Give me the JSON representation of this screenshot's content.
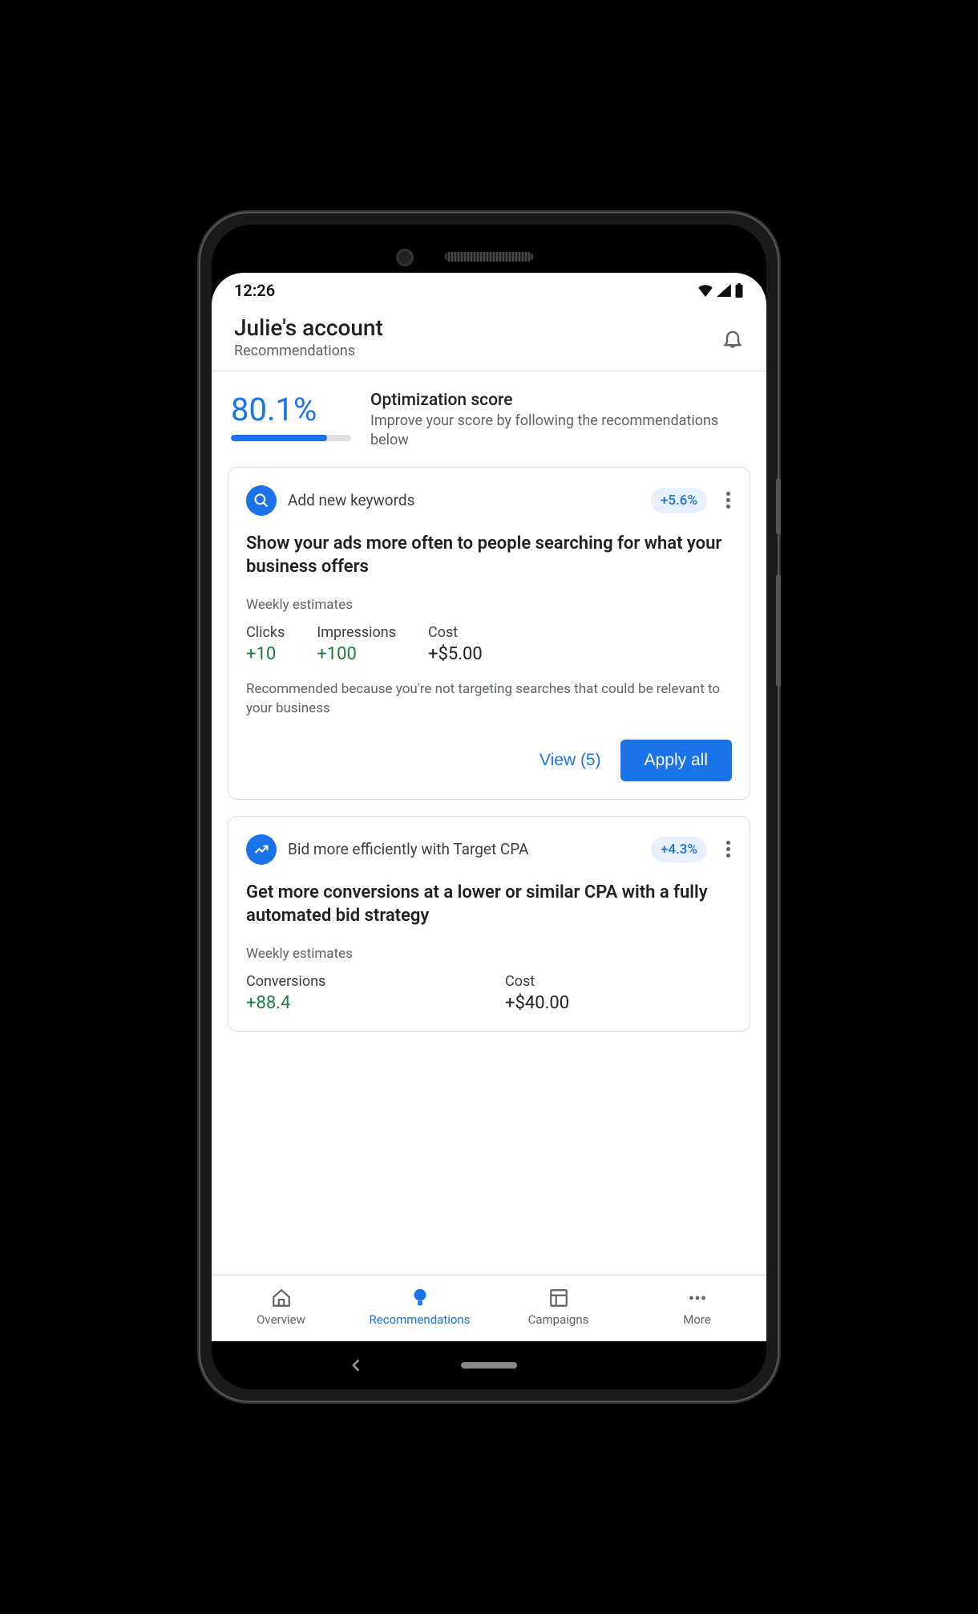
{
  "statusbar": {
    "time": "12:26"
  },
  "header": {
    "title": "Julie's account",
    "subtitle": "Recommendations"
  },
  "score": {
    "value": "80.1%",
    "fill_percent": 80.1,
    "title": "Optimization score",
    "desc": "Improve your score by following the recommendations below"
  },
  "cards": [
    {
      "icon": "search",
      "title": "Add new keywords",
      "badge": "+5.6%",
      "heading": "Show your ads more often to people searching for what your business offers",
      "weekly_label": "Weekly estimates",
      "metrics": [
        {
          "label": "Clicks",
          "value": "+10",
          "color": "green"
        },
        {
          "label": "Impressions",
          "value": "+100",
          "color": "green"
        },
        {
          "label": "Cost",
          "value": "+$5.00",
          "color": "black"
        }
      ],
      "footer_text": "Recommended because you're not targeting searches that could be relevant to your business",
      "view_label": "View (5)",
      "apply_label": "Apply all"
    },
    {
      "icon": "trend",
      "title": "Bid more efficiently with Target CPA",
      "badge": "+4.3%",
      "heading": "Get more conversions at a lower or similar CPA with a fully automated bid strategy",
      "weekly_label": "Weekly estimates",
      "metrics": [
        {
          "label": "Conversions",
          "value": "+88.4",
          "color": "green"
        },
        {
          "label": "Cost",
          "value": "+$40.00",
          "color": "black"
        }
      ]
    }
  ],
  "nav": {
    "items": [
      {
        "label": "Overview",
        "icon": "home"
      },
      {
        "label": "Recommendations",
        "icon": "bulb",
        "active": true
      },
      {
        "label": "Campaigns",
        "icon": "grid"
      },
      {
        "label": "More",
        "icon": "dots"
      }
    ]
  }
}
